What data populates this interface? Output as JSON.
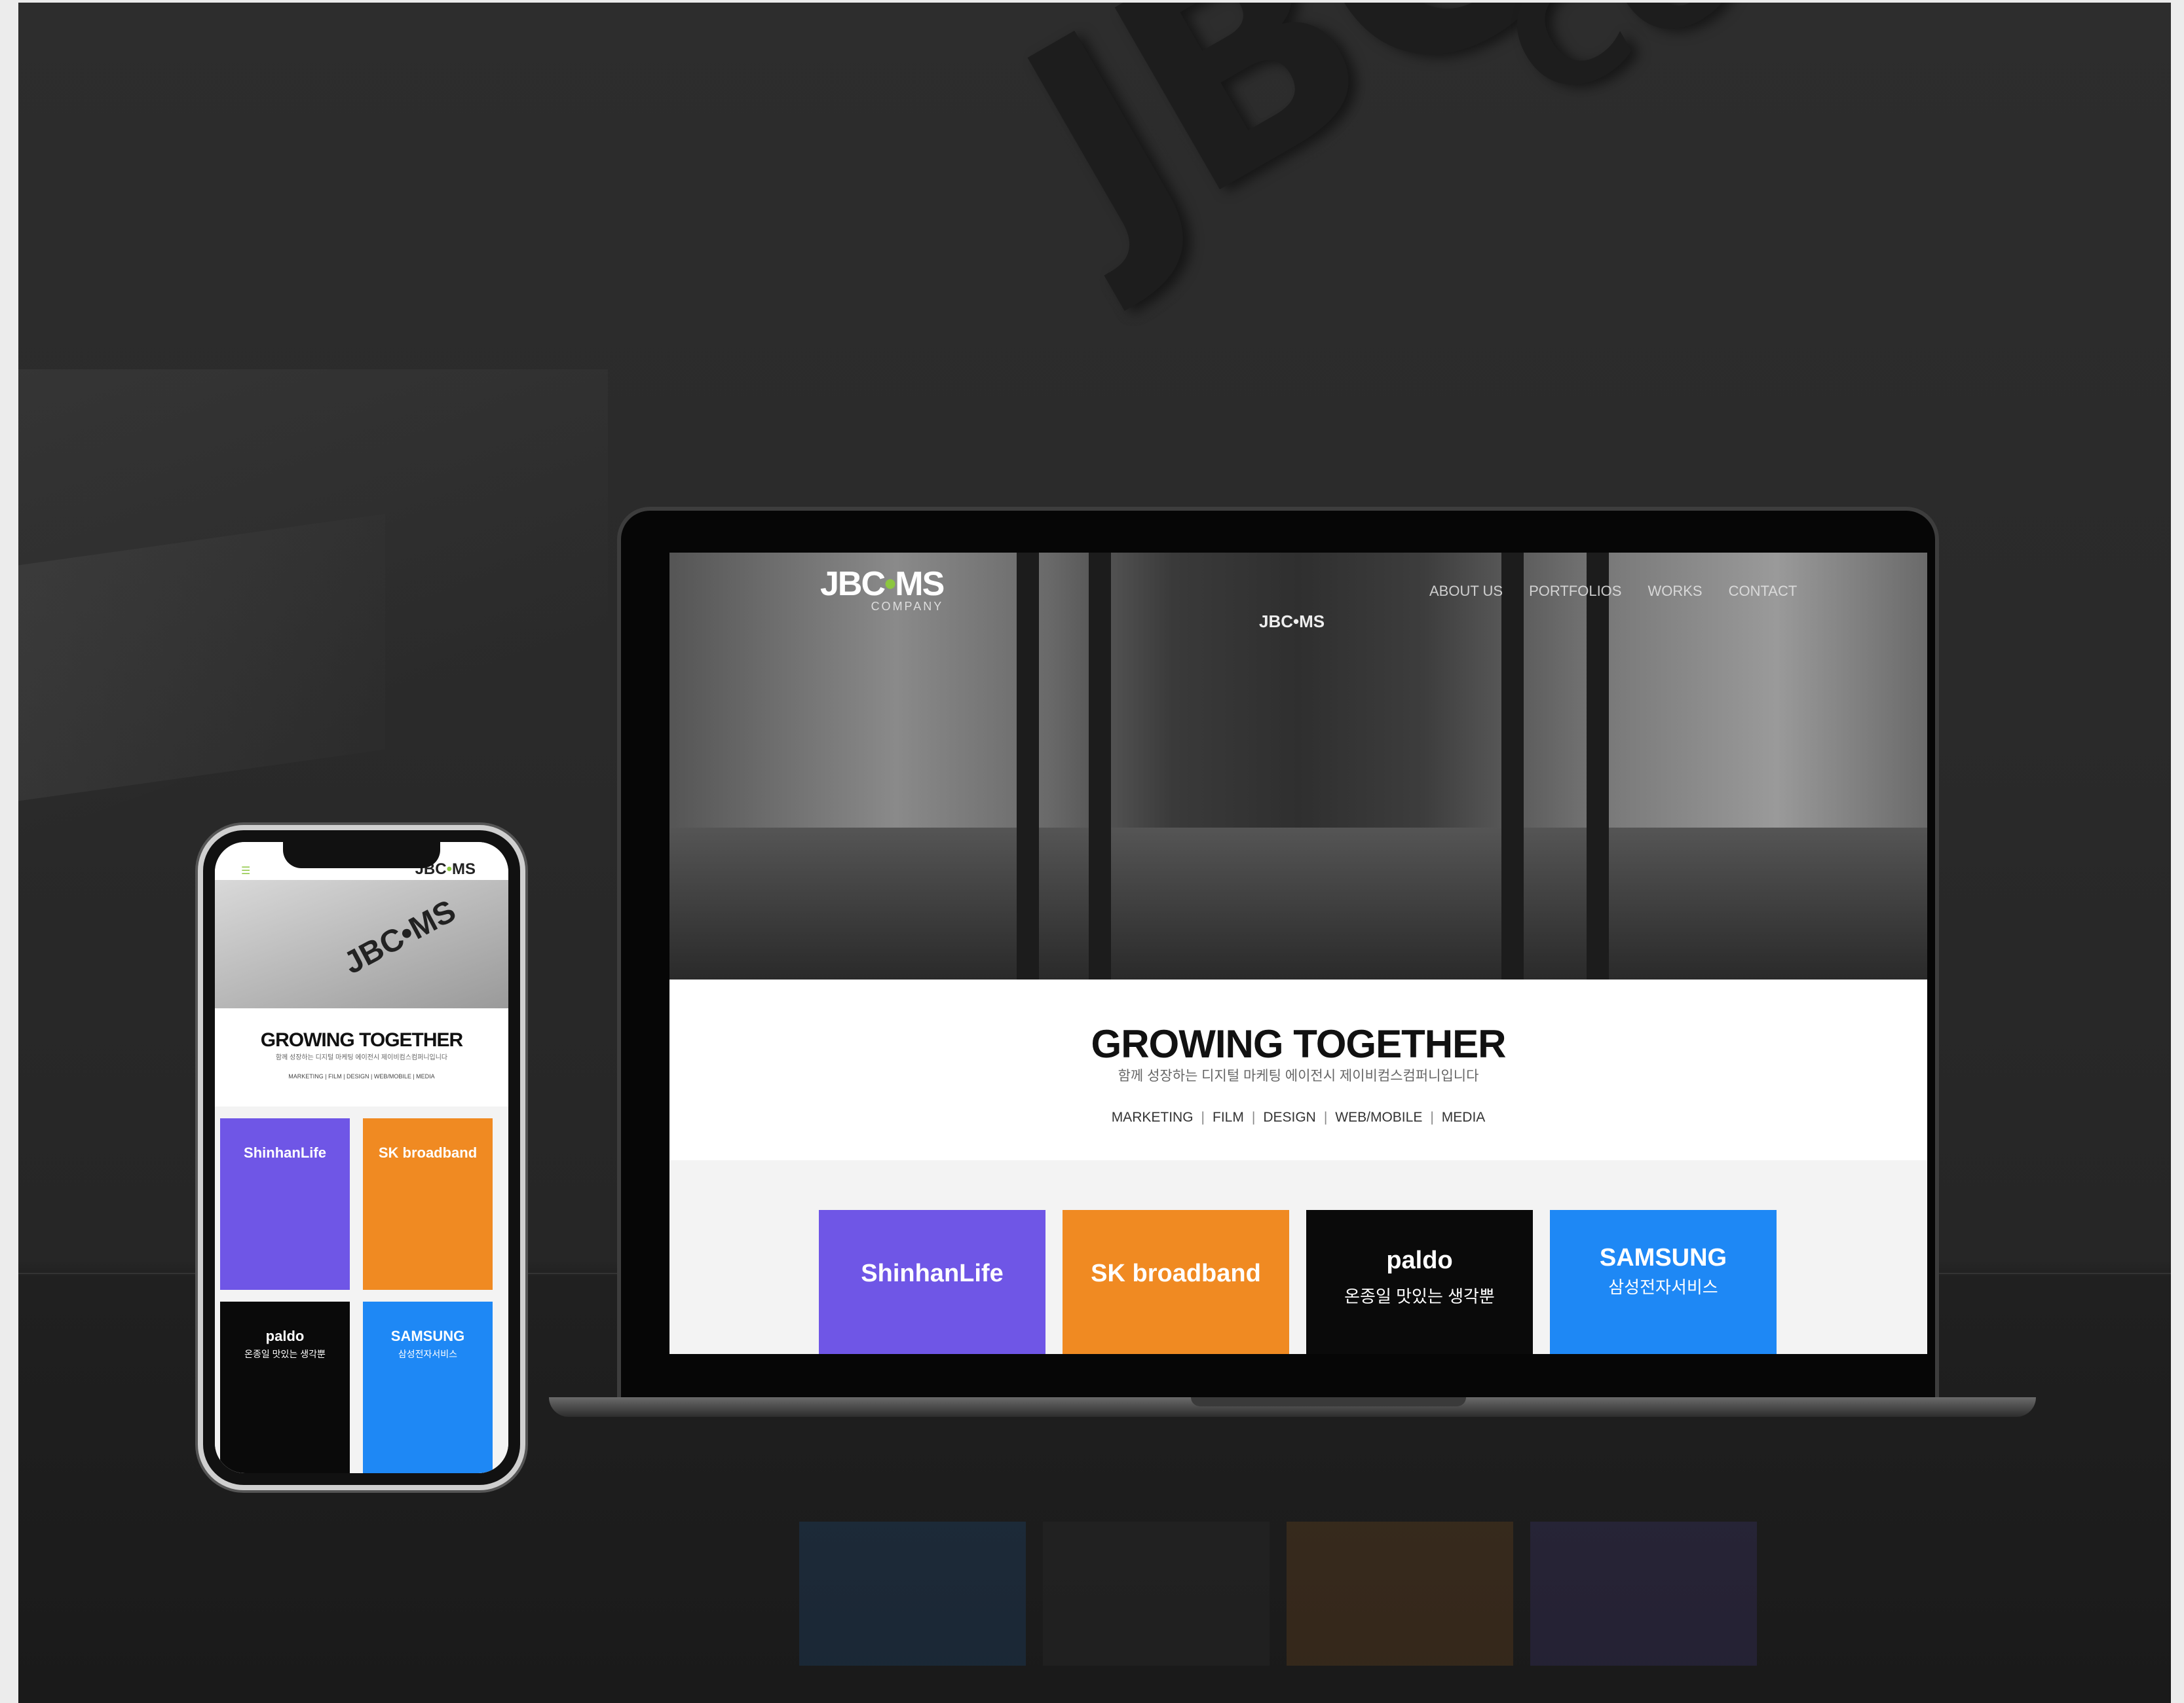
{
  "backdrop": {
    "wall_logo_main": "JBC•MS",
    "wall_logo_sub": "COMPANY"
  },
  "desktop": {
    "logo": {
      "part1": "JBC",
      "dot": "•",
      "part2": "MS",
      "sub": "COMPANY"
    },
    "hero_sign": "JBC•MS",
    "nav": [
      "ABOUT US",
      "PORTFOLIOS",
      "WORKS",
      "CONTACT"
    ],
    "headline": "GROWING TOGETHER",
    "tagline": "함께 성장하는 디지털 마케팅 에이전시 제이비컴스컴퍼니입니다",
    "categories": [
      "MARKETING",
      "FILM",
      "DESIGN",
      "WEB/MOBILE",
      "MEDIA"
    ],
    "separator": "|",
    "works": [
      {
        "name": "ShinhanLife",
        "sub": "",
        "color": "#6f56e6"
      },
      {
        "name": "SK broadband",
        "sub": "",
        "color": "#f08a22"
      },
      {
        "name": "paldo",
        "sub": "온종일 맛있는 생각뿐",
        "color": "#0a0a0a"
      },
      {
        "name": "SAMSUNG",
        "sub": "삼성전자서비스",
        "color": "#1e88f5"
      }
    ]
  },
  "mobile": {
    "logo": {
      "part1": "JBC",
      "dot": "•",
      "part2": "MS"
    },
    "hero_wall": "JBC•MS",
    "headline": "GROWING TOGETHER",
    "tagline": "함께 성장하는 디지털 마케팅 에이전시 제이비컴스컴퍼니입니다",
    "categories_line": "MARKETING | FILM | DESIGN | WEB/MOBILE | MEDIA",
    "works": [
      {
        "name": "ShinhanLife",
        "sub": "",
        "color": "#6f56e6"
      },
      {
        "name": "SK broadband",
        "sub": "",
        "color": "#f08a22"
      },
      {
        "name": "paldo",
        "sub": "온종일 맛있는 생각뿐",
        "color": "#0a0a0a"
      },
      {
        "name": "SAMSUNG",
        "sub": "삼성전자서비스",
        "color": "#1e88f5"
      }
    ]
  },
  "colors": {
    "accent_green": "#8cc63f"
  }
}
